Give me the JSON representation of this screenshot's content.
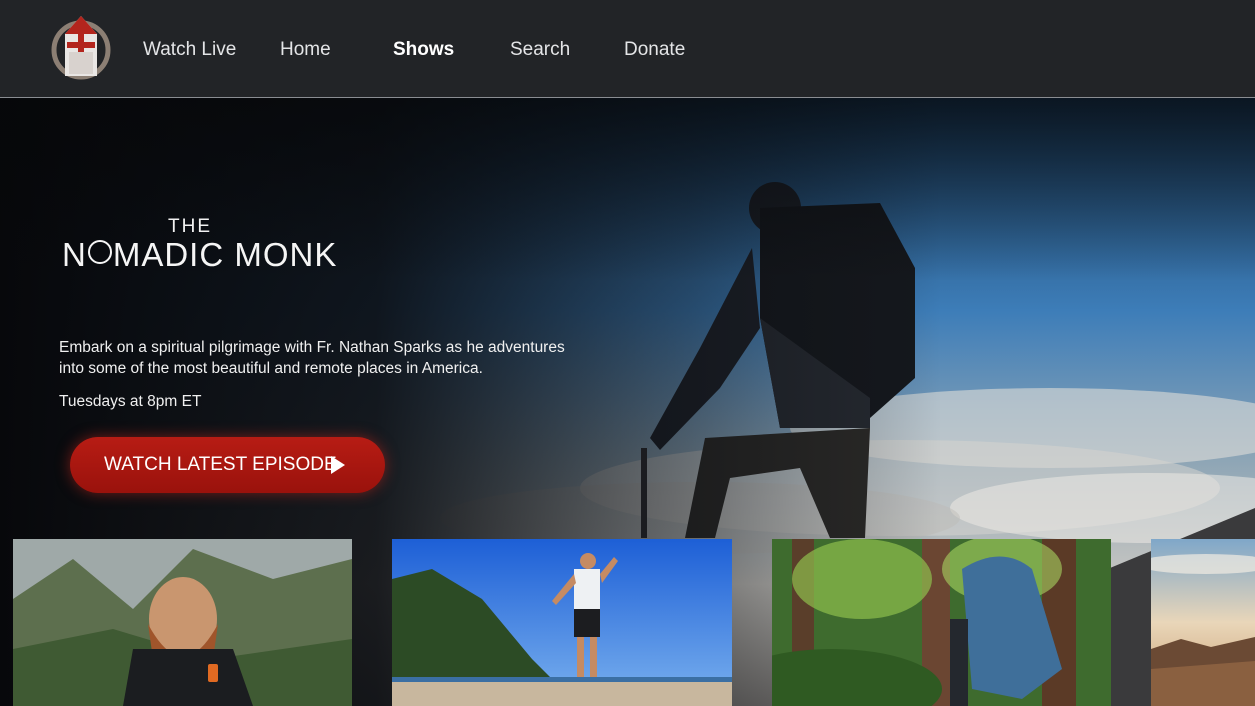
{
  "nav": {
    "logo_icon": "church-logo-icon",
    "items": [
      {
        "label": "Watch Live"
      },
      {
        "label": "Home"
      },
      {
        "label": "Shows"
      },
      {
        "label": "Search"
      },
      {
        "label": "Donate"
      }
    ],
    "active": "Shows"
  },
  "hero": {
    "show_title_prefix": "THE",
    "show_title_part1": "N",
    "show_title_part2": "MADIC MONK",
    "description": "Embark on a spiritual pilgrimage with Fr. Nathan Sparks as he adventures into some of the most beautiful and remote places in America.",
    "airtime": "Tuesdays at 8pm ET",
    "cta_label": "WATCH LATEST EPISODE",
    "cta_icon": "play-icon"
  },
  "episodes": [
    {
      "image": "bearded-hiker-mountain-thumbnail"
    },
    {
      "image": "hiker-on-beach-thumbnail"
    },
    {
      "image": "hiker-in-redwood-forest-thumbnail"
    },
    {
      "image": "desert-landscape-thumbnail"
    }
  ],
  "colors": {
    "topbar": "#222427",
    "accent_red": "#b71c14",
    "sky_blue": "#3a7bb8"
  }
}
